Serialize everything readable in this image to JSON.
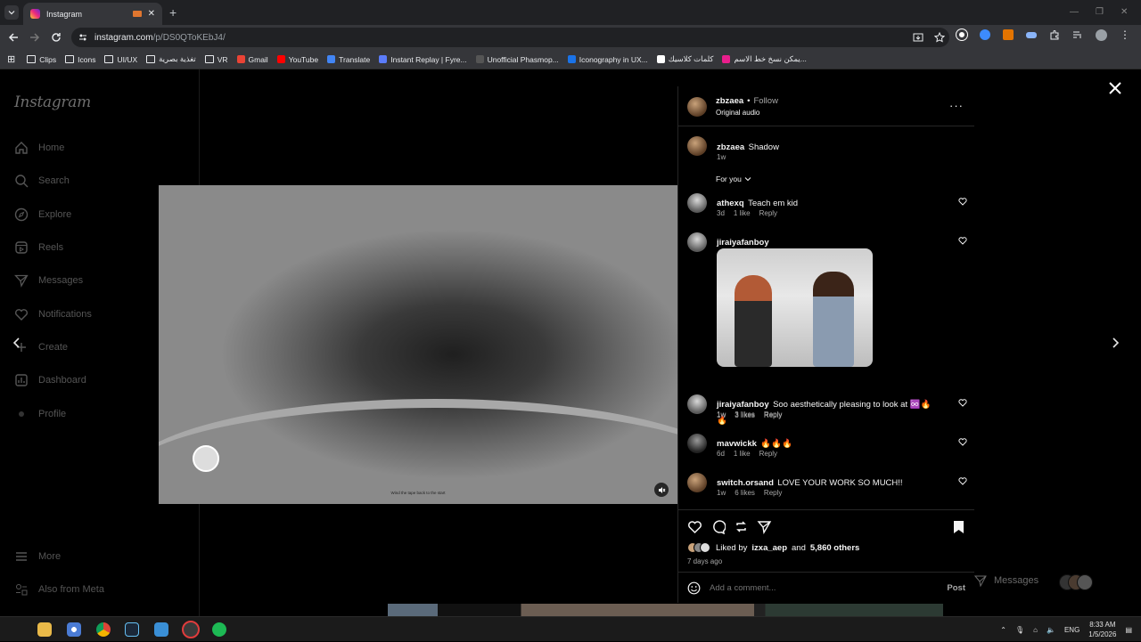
{
  "browser": {
    "tab_title": "Instagram",
    "url_host": "instagram.com",
    "url_path": "/p/DS0QToKEbJ4/",
    "bookmarks": [
      {
        "label": "Clips",
        "icon": "folder-icon"
      },
      {
        "label": "Icons",
        "icon": "folder-icon"
      },
      {
        "label": "UI/UX",
        "icon": "folder-icon"
      },
      {
        "label": "تغذية بصرية",
        "icon": "folder-icon"
      },
      {
        "label": "VR",
        "icon": "folder-icon"
      },
      {
        "label": "Gmail",
        "icon": "gmail-icon"
      },
      {
        "label": "YouTube",
        "icon": "youtube-icon"
      },
      {
        "label": "Translate",
        "icon": "translate-icon"
      },
      {
        "label": "Instant Replay | Fyre...",
        "icon": "fyre-icon"
      },
      {
        "label": "Unofficial Phasmop...",
        "icon": "question-icon"
      },
      {
        "label": "Iconography in UX...",
        "icon": "c-icon"
      },
      {
        "label": "كلمات كلاسيك",
        "icon": "doc-icon"
      },
      {
        "label": "يمكن نسخ خط الاسم...",
        "icon": "pink-icon"
      }
    ]
  },
  "sidebar": {
    "logo": "Instagram",
    "items": [
      {
        "label": "Home",
        "icon": "home-icon"
      },
      {
        "label": "Search",
        "icon": "search-icon"
      },
      {
        "label": "Explore",
        "icon": "compass-icon"
      },
      {
        "label": "Reels",
        "icon": "reels-icon"
      },
      {
        "label": "Messages",
        "icon": "messages-icon"
      },
      {
        "label": "Notifications",
        "icon": "heart-icon"
      },
      {
        "label": "Create",
        "icon": "plus-icon"
      },
      {
        "label": "Dashboard",
        "icon": "dashboard-icon"
      },
      {
        "label": "Profile",
        "icon": "profile-icon"
      }
    ],
    "more": "More",
    "meta": "Also from Meta"
  },
  "post": {
    "video_caption": "Wind the tape back to the start"
  },
  "panel": {
    "author": "zbzaea",
    "follow": "Follow",
    "audio": "Original audio",
    "caption_author": "zbzaea",
    "caption_text": "Shadow",
    "caption_time": "1w",
    "sort": "For you",
    "comments": [
      {
        "user": "athexq",
        "text": "Teach em kid",
        "time": "3d",
        "likes": "1 like",
        "reply": "Reply"
      },
      {
        "user": "jiraiyafanboy",
        "text": "",
        "time": "1w",
        "likes": "3 likes",
        "reply": "Reply"
      },
      {
        "user": "jiraiyafanboy",
        "text": "Soo aesthetically pleasing to look at ♾️🔥🔥",
        "time": "1w",
        "likes": "3 likes",
        "reply": "Reply"
      },
      {
        "user": "mavwickk",
        "text": "🔥🔥🔥",
        "time": "6d",
        "likes": "1 like",
        "reply": "Reply"
      },
      {
        "user": "switch.orsand",
        "text": "LOVE YOUR WORK SO MUCH!!",
        "time": "1w",
        "likes": "6 likes",
        "reply": "Reply"
      }
    ],
    "liked_prefix": "Liked by",
    "liked_user": "izxa_aep",
    "liked_and": "and",
    "liked_others": "5,860 others",
    "posted_ago": "7 days ago",
    "add_comment_placeholder": "Add a comment...",
    "post_button": "Post"
  },
  "floating": {
    "messages": "Messages"
  },
  "taskbar": {
    "lang": "ENG",
    "time": "8:33 AM",
    "date": "1/5/2026"
  }
}
